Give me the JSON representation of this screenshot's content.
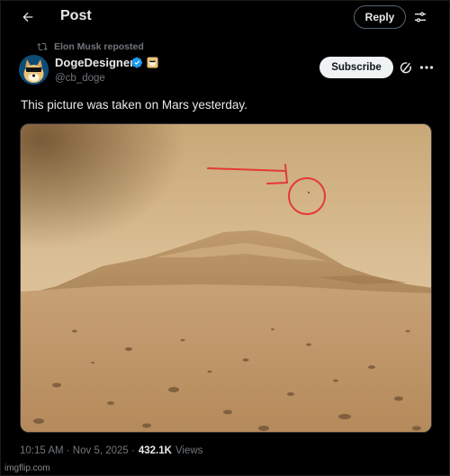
{
  "header": {
    "title": "Post",
    "reply_label": "Reply",
    "back_icon": "arrow-left-icon",
    "filter_icon": "sliders-icon"
  },
  "repost": {
    "icon": "repost-icon",
    "text": "Elon Musk reposted"
  },
  "author": {
    "name": "DogeDesigner",
    "handle": "@cb_doge",
    "verified_icon": "verified-badge-icon",
    "affiliate_icon": "affiliate-badge-icon",
    "subscribe_label": "Subscribe",
    "grok_icon": "grok-icon",
    "more_icon": "more-icon"
  },
  "tweet": {
    "text": "This picture was taken on Mars yesterday.",
    "media_alt": "Mars landscape with hill and red circled spot in the sky"
  },
  "meta": {
    "time": "10:15 AM · Nov 5, 2025 ·",
    "views_count": "432.1K",
    "views_label": "Views"
  },
  "watermark": "imgflip.com",
  "colors": {
    "background": "#000000",
    "text_primary": "#e7e9ea",
    "text_secondary": "#71767b",
    "accent_blue": "#1d9bf0",
    "annotation_red": "#e53935",
    "mars_sky": "#d8b98a",
    "mars_ground": "#c09466"
  }
}
